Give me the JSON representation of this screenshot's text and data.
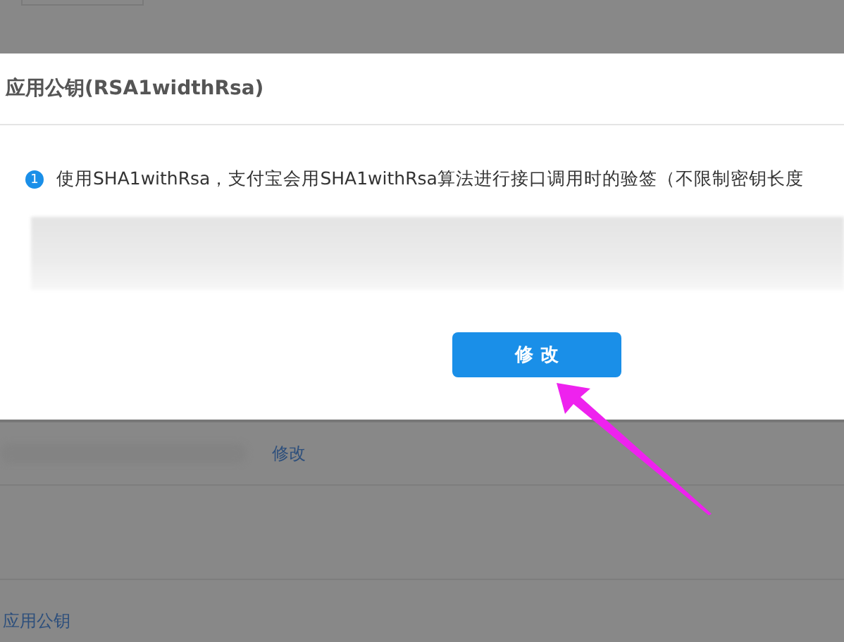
{
  "dialog": {
    "title": "应用公钥(RSA1widthRsa)",
    "info_icon": "1",
    "message": "使用SHA1withRsa，支付宝会用SHA1withRsa算法进行接口调用时的验签（不限制密钥长度",
    "button": "修 改"
  },
  "background_page": {
    "edit_link": "修改",
    "bottom_link": "应用公钥"
  }
}
